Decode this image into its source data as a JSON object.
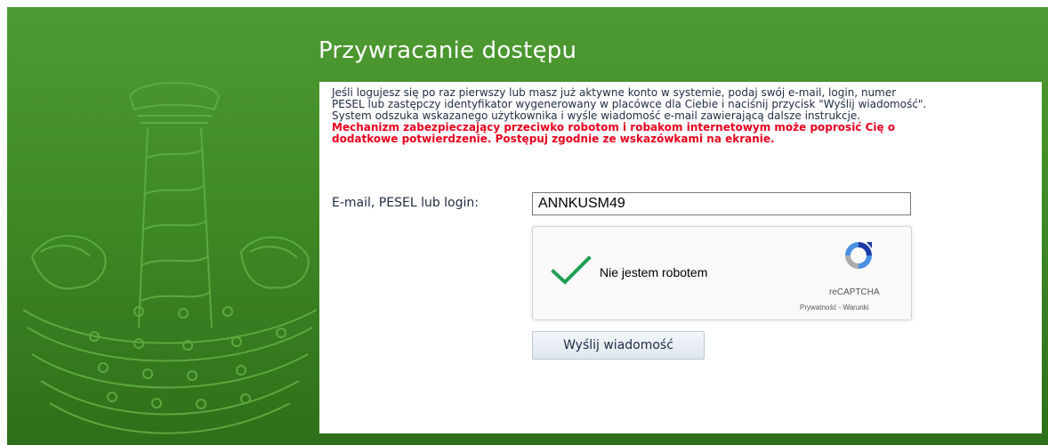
{
  "page": {
    "title": "Przywracanie dostępu"
  },
  "info": {
    "line1": "Jeśli logujesz się po raz pierwszy lub masz już aktywne konto w systemie, podaj swój e-mail, login, numer",
    "line2": "PESEL lub zastępczy identyfikator wygenerowany w placówce dla Ciebie i naciśnij przycisk \"Wyślij wiadomość\".",
    "line3": "System odszuka wskazanego użytkownika i wyśle wiadomość e-mail zawierającą dalsze instrukcje.",
    "warning1": "Mechanizm zabezpieczający przeciwko robotom i robakom internetowym może poprosić Cię o",
    "warning2": "dodatkowe potwierdzenie. Postępuj zgodnie ze wskazówkami na ekranie."
  },
  "form": {
    "login_label": "E-mail, PESEL lub login:",
    "login_value": "ANNKUSM49",
    "send_label": "Wyślij wiadomość"
  },
  "captcha": {
    "text": "Nie jestem robotem",
    "brand": "reCAPTCHA",
    "privacy": "Prywatność",
    "separator": " - ",
    "terms": "Warunki",
    "checked": true
  },
  "colors": {
    "background_green": "#3f8a26",
    "warning_red": "#e8001c",
    "check_green": "#1e9e52"
  }
}
